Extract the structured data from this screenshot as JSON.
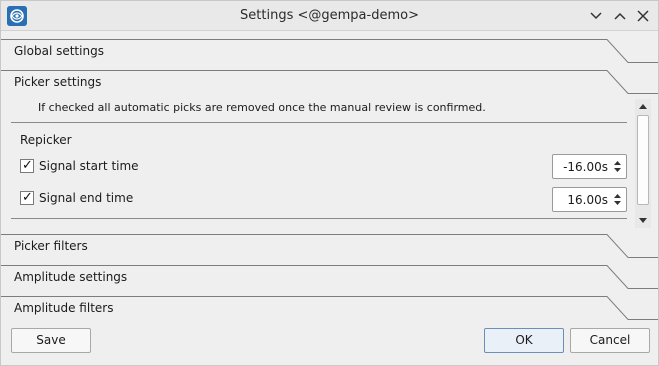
{
  "window": {
    "title": "Settings <@gempa-demo>",
    "icon": "app-logo-icon",
    "controls": [
      "minimize-icon",
      "maximize-icon",
      "close-icon"
    ]
  },
  "sections": {
    "global": {
      "label": "Global settings"
    },
    "picker": {
      "label": "Picker settings"
    },
    "picker_filters": {
      "label": "Picker filters"
    },
    "amplitude_settings": {
      "label": "Amplitude settings"
    },
    "amplitude_filters": {
      "label": "Amplitude filters"
    }
  },
  "picker": {
    "info": "If checked all automatic picks are removed once the manual review is confirmed.",
    "repicker": {
      "title": "Repicker",
      "signal_start": {
        "label": "Signal start time",
        "checked": true,
        "value": "-16.00s"
      },
      "signal_end": {
        "label": "Signal end time",
        "checked": true,
        "value": "16.00s"
      }
    }
  },
  "buttons": {
    "save": "Save",
    "ok": "OK",
    "cancel": "Cancel"
  }
}
